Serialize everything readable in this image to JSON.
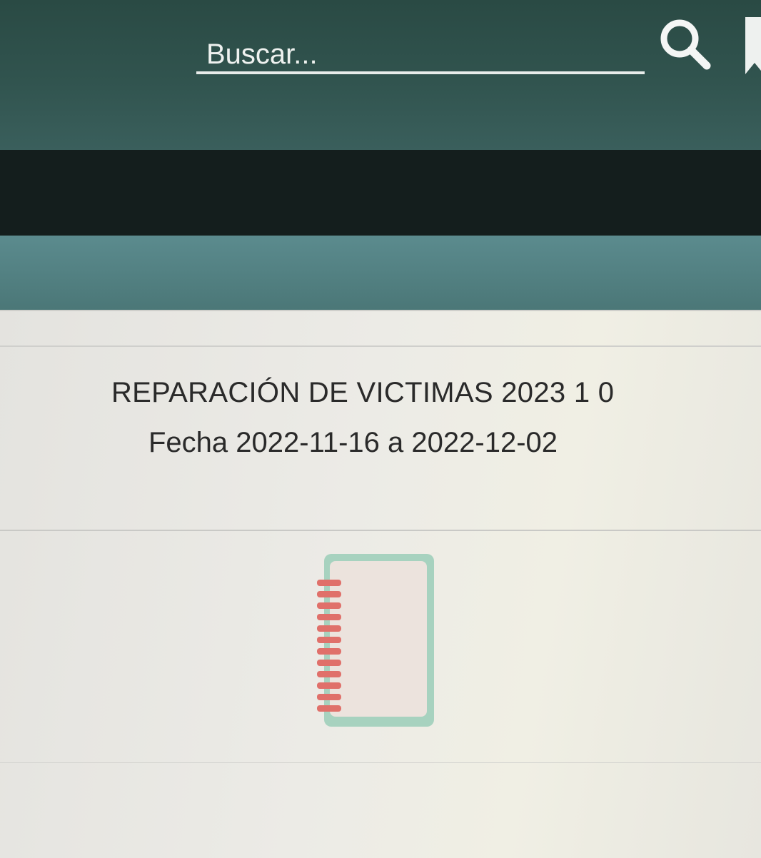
{
  "header": {
    "search": {
      "placeholder": "Buscar...",
      "value": ""
    },
    "icons": {
      "search": "search-icon",
      "bookmark": "bookmark-icon"
    }
  },
  "report": {
    "title": "REPARACIÓN DE VICTIMAS 2023 1 0",
    "date_range": "Fecha 2022-11-16 a 2022-12-02",
    "icon": "notebook-icon"
  },
  "colors": {
    "header": "#31544f",
    "dark_band": "#141e1d",
    "teal_band": "#557f82",
    "notebook_border": "#8fc6b0",
    "notebook_spiral": "#e0706a"
  }
}
